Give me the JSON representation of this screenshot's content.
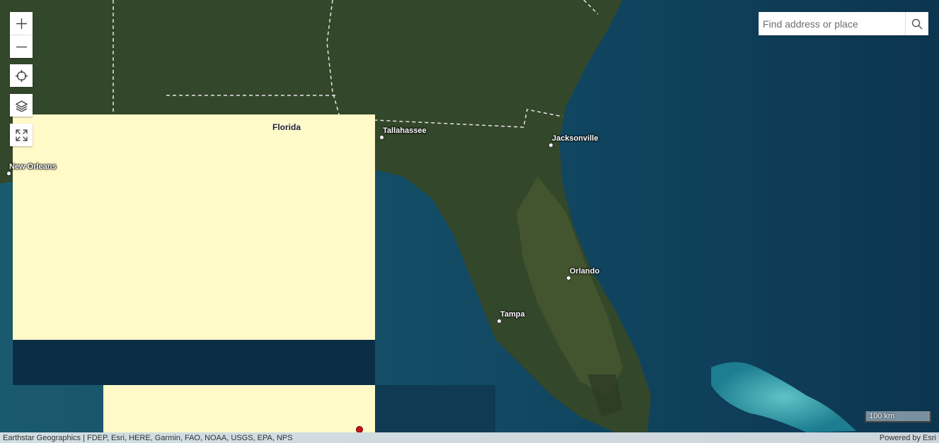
{
  "zoom_controls": {
    "zoom_in_icon": "plus-icon",
    "zoom_out_icon": "minus-icon"
  },
  "tools": {
    "locate_icon": "crosshair-icon",
    "layers_icon": "layers-icon",
    "fullscreen_icon": "expand-icon"
  },
  "search": {
    "placeholder": "Find address or place",
    "icon": "search-icon"
  },
  "map_labels": {
    "state": "Florida",
    "cities": [
      "Tallahassee",
      "Jacksonville",
      "New Orleans",
      "Orlando",
      "Tampa"
    ]
  },
  "scale_bar": {
    "label": "100 km"
  },
  "attribution": {
    "sources": "Earthstar Geographics | FDEP, Esri, HERE, Garmin, FAO, NOAA, USGS, EPA, NPS",
    "powered_by": "Powered by Esri"
  },
  "colors": {
    "highlight_fill": "#fffac8",
    "marker": "#c8101a",
    "water": "#0e3a52",
    "land": "#33472a"
  }
}
